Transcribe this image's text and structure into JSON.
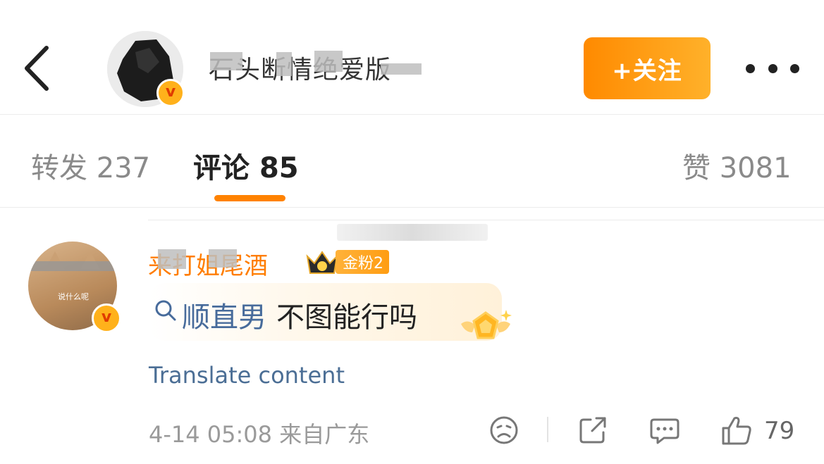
{
  "header": {
    "username": "石头断情绝爱版",
    "follow_label": "+关注"
  },
  "tabs": [
    {
      "label": "转发",
      "count": "237"
    },
    {
      "label": "评论",
      "count": "85"
    },
    {
      "label": "赞",
      "count": "3081"
    }
  ],
  "comment": {
    "author": "来打姐尾酒",
    "fan_badge": "金粉2",
    "avatar_caption": "说什么呢",
    "search_link": "顺直男",
    "text": "不图能行吗",
    "translate_label": "Translate content",
    "timestamp": "4-14 05:08",
    "location": "来自广东",
    "like_count": "79"
  },
  "colors": {
    "accent": "#ff8200",
    "link": "#476b9b",
    "verified": "#ffb11b"
  },
  "icons": [
    "back-arrow-icon",
    "verified-badge-icon",
    "more-dots-icon",
    "search-icon",
    "crown-icon",
    "medal-icon",
    "sad-face-icon",
    "share-icon",
    "comment-icon",
    "like-icon"
  ]
}
